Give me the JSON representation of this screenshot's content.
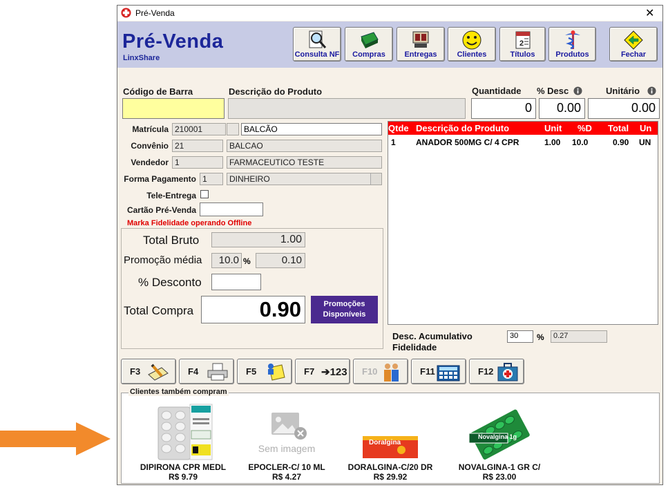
{
  "window": {
    "title": "Pré-Venda",
    "close": "✕"
  },
  "header": {
    "title": "Pré-Venda",
    "subtitle": "LinxShare",
    "buttons": [
      {
        "label": "Consulta NF",
        "icon": "magnifier-icon"
      },
      {
        "label": "Compras",
        "icon": "cash-register-icon"
      },
      {
        "label": "Entregas",
        "icon": "delivery-phone-icon"
      },
      {
        "label": "Clientes",
        "icon": "smiley-icon"
      },
      {
        "label": "Títulos",
        "icon": "calendar-icon"
      },
      {
        "label": "Produtos",
        "icon": "caduceus-icon"
      },
      {
        "label": "Fechar",
        "icon": "exit-arrow-icon"
      }
    ]
  },
  "entry": {
    "barcode_label": "Código de Barra",
    "barcode_value": "",
    "desc_label": "Descrição do Produto",
    "desc_value": "",
    "qty_label": "Quantidade",
    "qty_value": "0",
    "disc_label": "% Desc",
    "disc_value": "0.00",
    "unit_label": "Unitário",
    "unit_value": "0.00"
  },
  "form": {
    "matricula_label": "Matrícula",
    "matricula_code": "210001",
    "matricula_extra": "",
    "matricula_name": "BALCÃO",
    "convenio_label": "Convênio",
    "convenio_code": "21",
    "convenio_name": "BALCAO",
    "vendedor_label": "Vendedor",
    "vendedor_code": "1",
    "vendedor_name": "FARMACEUTICO TESTE",
    "pagamento_label": "Forma Pagamento",
    "pagamento_code": "1",
    "pagamento_name": "DINHEIRO",
    "tele_label": "Tele-Entrega",
    "cartao_label": "Cartão Pré-Venda",
    "cartao_value": "",
    "fidelidade_warning": "Marka Fidelidade operando Offline"
  },
  "totals": {
    "bruto_label": "Total Bruto",
    "bruto_value": "1.00",
    "promo_label": "Promoção média",
    "promo_pct": "10.0",
    "promo_pct_sign": "%",
    "promo_value": "0.10",
    "desc_label": "% Desconto",
    "desc_value": "",
    "compra_label": "Total Compra",
    "compra_value": "0.90",
    "promo_button": "Promoções Disponíveis"
  },
  "grid": {
    "columns": [
      "Qtde",
      "Descrição do Produto",
      "Unit",
      "%D",
      "Total",
      "Un"
    ],
    "rows": [
      {
        "qtde": "1",
        "desc": "ANADOR 500MG C/ 4 CPR",
        "unit": "1.00",
        "d": "10.0",
        "total": "0.90",
        "un": "UN"
      }
    ]
  },
  "fidelity": {
    "label_line1": "Desc. Acumulativo",
    "label_line2": "Fidelidade",
    "pct": "30",
    "pct_sign": "%",
    "value": "0.27"
  },
  "fkeys": [
    {
      "key": "F3",
      "icon": "edit-pencil-icon",
      "enabled": true
    },
    {
      "key": "F4",
      "icon": "printer-icon",
      "enabled": true
    },
    {
      "key": "F5",
      "icon": "notes-person-icon",
      "enabled": true
    },
    {
      "key": "F7",
      "icon": "barcode-number-icon",
      "text": "➔123",
      "enabled": true
    },
    {
      "key": "F10",
      "icon": "people-icon",
      "enabled": false
    },
    {
      "key": "F11",
      "icon": "calculator-icon",
      "enabled": true
    },
    {
      "key": "F12",
      "icon": "first-aid-kit-icon",
      "enabled": true
    }
  ],
  "recommend": {
    "title": "Clientes também compram",
    "no_image": "Sem imagem",
    "products": [
      {
        "name": "DIPIRONA CPR MEDL",
        "price": "R$ 9.79"
      },
      {
        "name": "EPOCLER-C/ 10 ML",
        "price": "R$ 4.27"
      },
      {
        "name": "DORALGINA-C/20 DR",
        "price": "R$ 29.92"
      },
      {
        "name": "NOVALGINA-1 GR C/",
        "price": "R$ 23.00"
      }
    ],
    "doralgina_box_text": "Doralgina",
    "novalgina_box_text": "Novalgina 1g"
  },
  "colors": {
    "header_bg": "#c7cbe5",
    "title_blue": "#1c2699",
    "grid_header": "#ff0000",
    "promo_button": "#4b2a8f",
    "window_bg": "#f7f1e8",
    "warning_red": "#e00000",
    "arrow": "#f28a2b"
  }
}
